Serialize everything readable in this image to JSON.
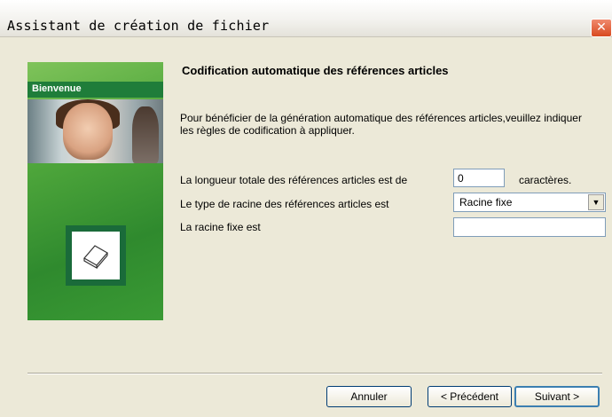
{
  "window": {
    "title": "Assistant de création de fichier",
    "close_glyph": "✕"
  },
  "side_panel": {
    "label": "Bienvenue",
    "image": "woman-photo",
    "icon": "document-icon"
  },
  "main": {
    "heading": "Codification automatique des références articles",
    "description": "Pour bénéficier de la génération automatique des références articles,veuillez indiquer les règles de codification à appliquer.",
    "length_label": "La longueur totale des références articles est de",
    "length_value": "0",
    "length_unit": "caractères.",
    "root_type_label": "Le type de racine des références articles est",
    "root_type_value": "Racine fixe",
    "fixed_root_label": "La racine fixe est",
    "fixed_root_value": ""
  },
  "buttons": {
    "cancel": "Annuler",
    "previous": "< Précédent",
    "next": "Suivant >"
  }
}
